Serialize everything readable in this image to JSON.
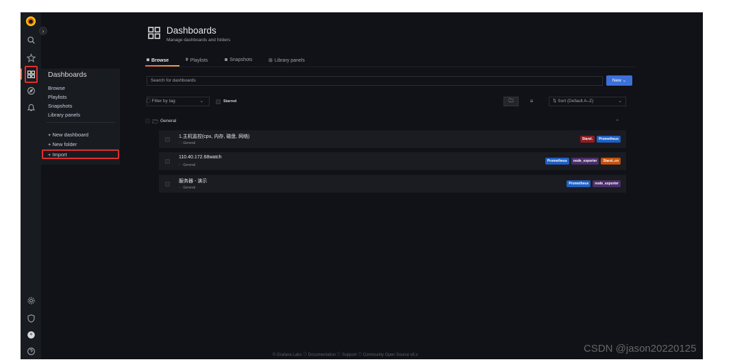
{
  "sidebar": {
    "icons": [
      "grafana-logo",
      "search-icon",
      "star-icon",
      "dashboards-icon",
      "explore-icon",
      "alerting-icon",
      "gear-icon",
      "shield-icon",
      "avatar",
      "help-icon"
    ],
    "flyout": {
      "title": "Dashboards",
      "items": [
        "Browse",
        "Playlists",
        "Snapshots",
        "Library panels"
      ],
      "actions": [
        "+  New dashboard",
        "+  New folder",
        "+  Import"
      ]
    }
  },
  "header": {
    "title": "Dashboards",
    "subtitle": "Manage dashboards and folders"
  },
  "tabs": [
    {
      "label": "Browse",
      "icon": "sitemap-icon"
    },
    {
      "label": "Playlists",
      "icon": "playlist-icon"
    },
    {
      "label": "Snapshots",
      "icon": "camera-icon"
    },
    {
      "label": "Library panels",
      "icon": "library-icon"
    }
  ],
  "search": {
    "placeholder": "Search for dashboards"
  },
  "new_button": "New ⌄",
  "filter": {
    "label": "⃝ Filter by tag",
    "caret": "⌄"
  },
  "starred_label": "Starred",
  "view_folder_icon": "🗀",
  "view_list_icon": "≡",
  "sort": {
    "label": "⇅ Sort (Default A–Z)",
    "caret": "⌄"
  },
  "folder": {
    "name": "General",
    "icon": "folder-open-icon",
    "collapse": "⌃"
  },
  "dashboards": [
    {
      "name": "1.主机监控(cpu, 内存, 磁盘, 网络)",
      "folder": "General",
      "tags": [
        {
          "label": "Starsl.",
          "color": "#8f1d21"
        },
        {
          "label": "Prometheus",
          "color": "#1f60c4"
        }
      ]
    },
    {
      "name": "110.40.172.68watch",
      "folder": "General",
      "tags": [
        {
          "label": "Prometheus",
          "color": "#1f60c4"
        },
        {
          "label": "node_exporter",
          "color": "#4a2f6b"
        },
        {
          "label": "Starsl..cn",
          "color": "#c4520c"
        }
      ]
    },
    {
      "name": "服务器 - 演示",
      "folder": "General",
      "tags": [
        {
          "label": "Prometheus",
          "color": "#1f60c4"
        },
        {
          "label": "node_exporter",
          "color": "#4a2f6b"
        }
      ]
    }
  ],
  "footer": "© Grafana Labs   ⓘ Documentation   ⓘ Support   ⓘ Community   Open Source   v8.x",
  "watermark": "CSDN @jason20220125"
}
